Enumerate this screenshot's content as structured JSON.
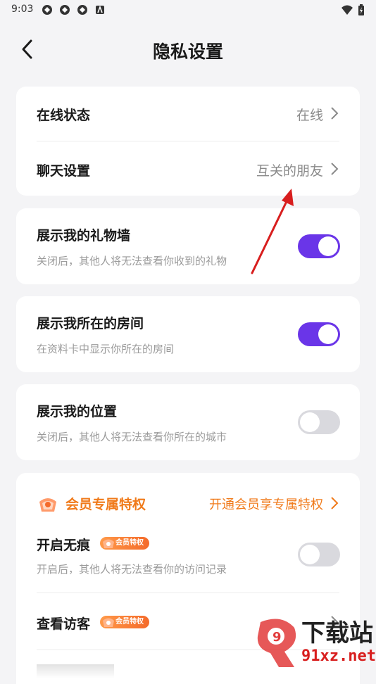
{
  "status_bar": {
    "time": "9:03"
  },
  "header": {
    "title": "隐私设置"
  },
  "cards": {
    "online_status": {
      "label": "在线状态",
      "value": "在线"
    },
    "chat_settings": {
      "label": "聊天设置",
      "value": "互关的朋友"
    },
    "gift_wall": {
      "label": "展示我的礼物墙",
      "desc": "关闭后，其他人将无法查看你收到的礼物",
      "enabled": true
    },
    "room": {
      "label": "展示我所在的房间",
      "desc": "在资料卡中显示你所在的房间",
      "enabled": true
    },
    "location": {
      "label": "展示我的位置",
      "desc": "关闭后，其他人将无法查看你所在的城市",
      "enabled": false
    },
    "vip": {
      "title": "会员专属特权",
      "link": "开通会员享专属特权",
      "stealth": {
        "label": "开启无痕",
        "badge": "会员特权",
        "desc": "开启后，其他人将无法查看你的访问记录",
        "enabled": false
      },
      "visitors": {
        "label": "查看访客",
        "badge": "会员特权"
      }
    }
  },
  "watermark": {
    "brand": "下载站",
    "url": "91xz.net"
  },
  "colors": {
    "accent": "#6a35e8",
    "vip": "#f07a1a",
    "annotation": "#d81e1e"
  }
}
